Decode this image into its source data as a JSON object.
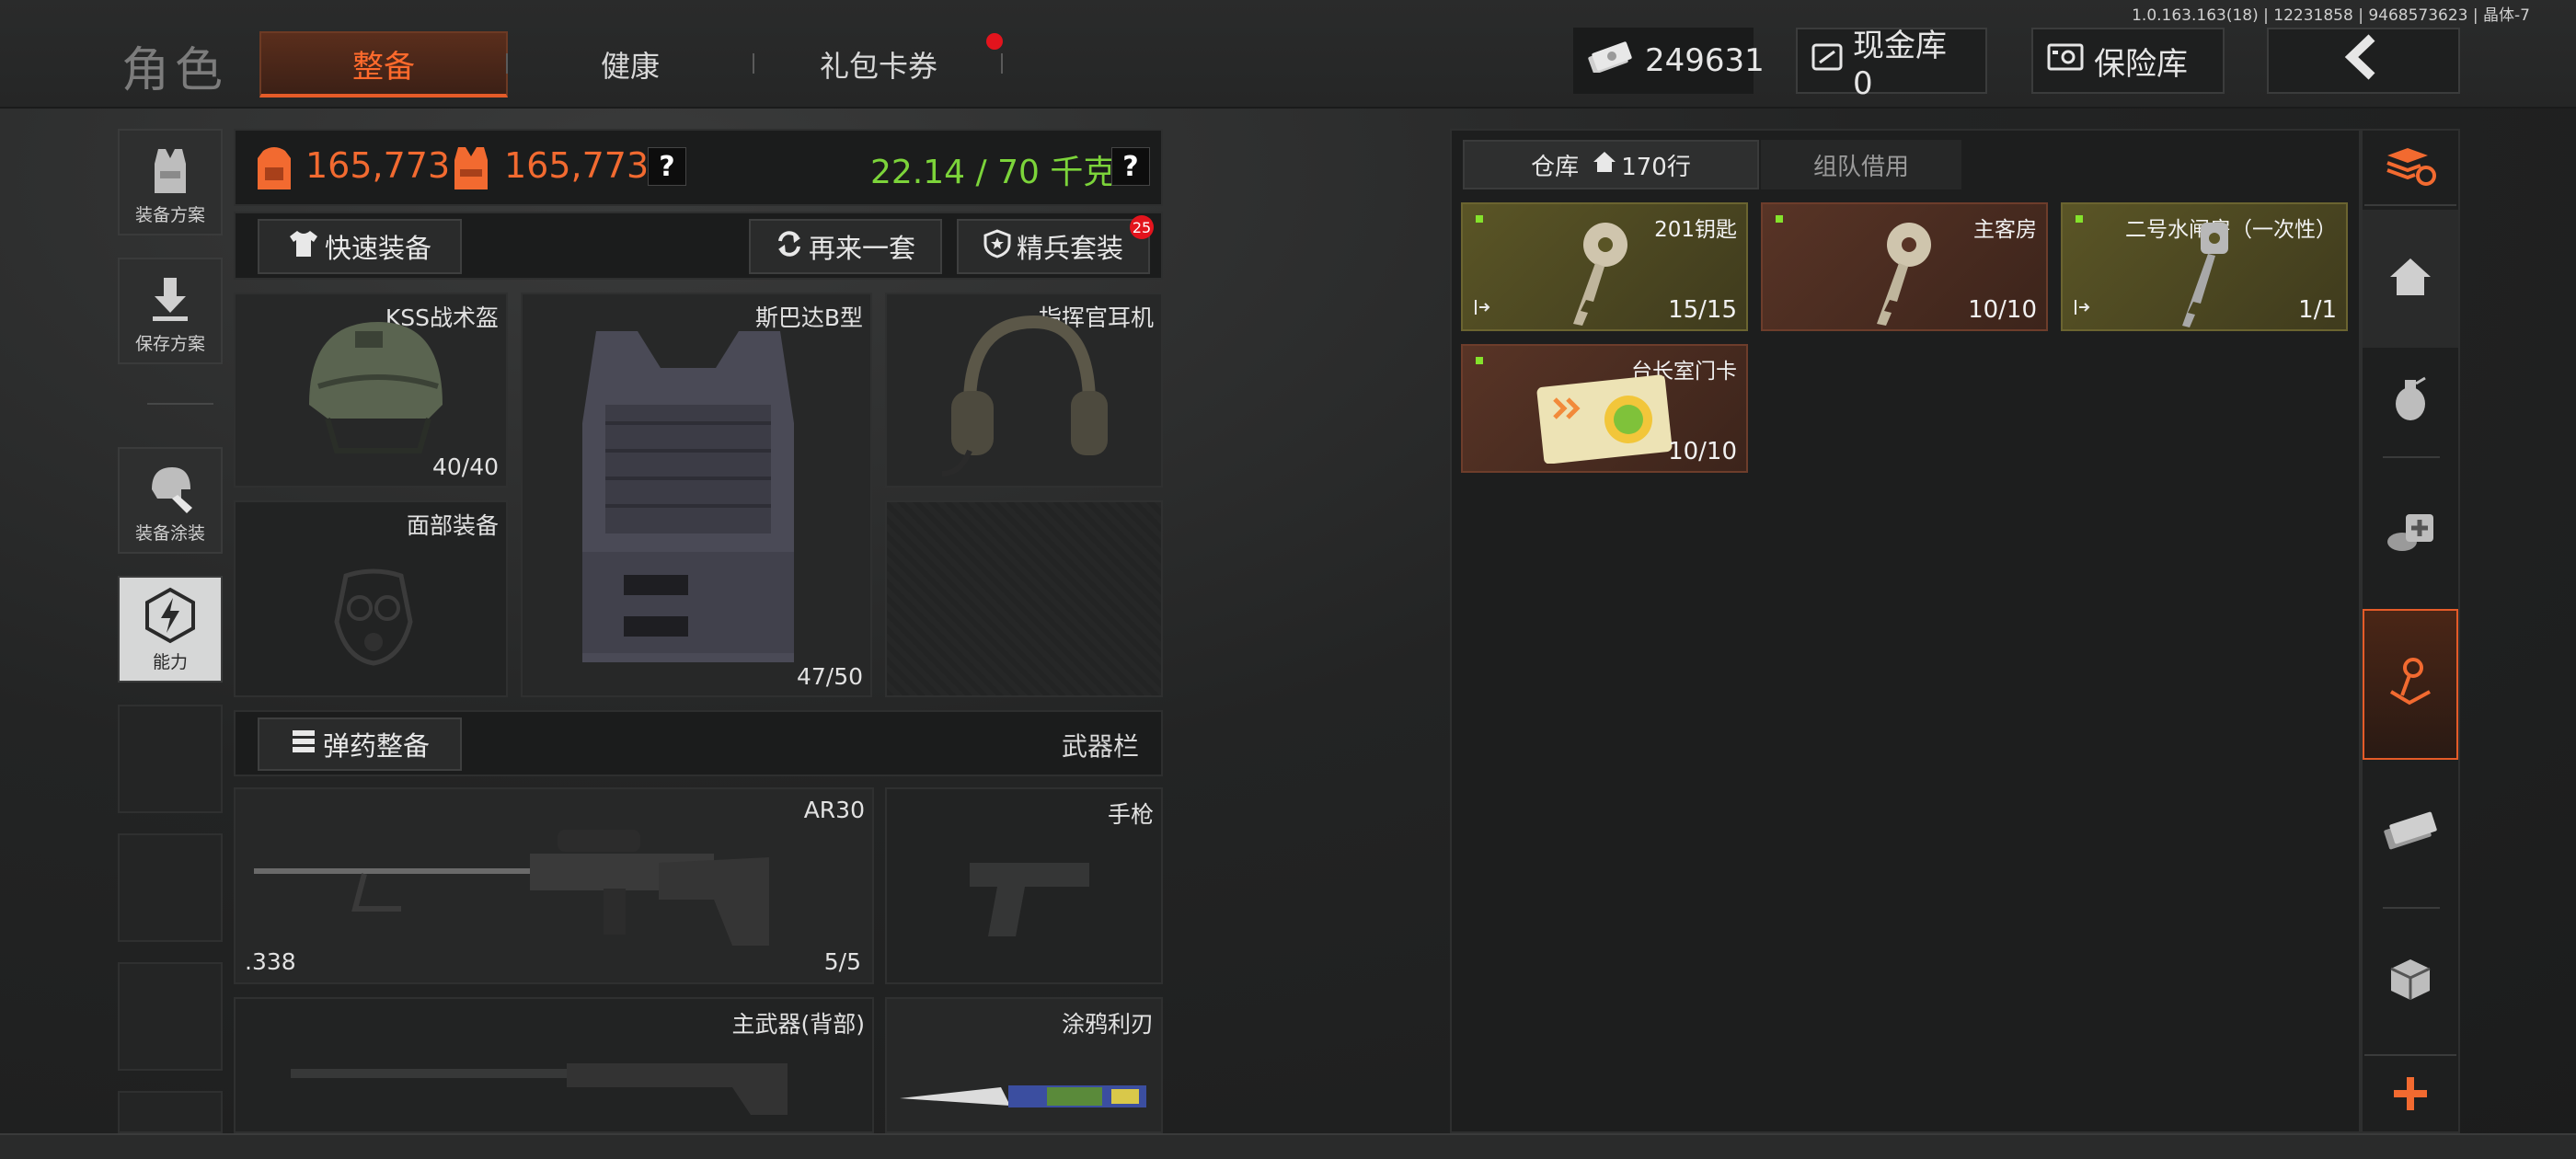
{
  "version": "1.0.163.163(18) | 12231858 | 9468573623 | 晶体-7",
  "header": {
    "title": "角色",
    "tabs": [
      {
        "label": "整备",
        "active": true
      },
      {
        "label": "健康",
        "active": false
      },
      {
        "label": "礼包卡券",
        "active": false,
        "badge": true
      }
    ],
    "currency": "249631",
    "cash_vault": "现金库 0",
    "safe_box": "保险库"
  },
  "sidebar": {
    "items": [
      {
        "label": "装备方案"
      },
      {
        "label": "保存方案"
      },
      {
        "label": "装备涂装"
      },
      {
        "label": "能力"
      }
    ]
  },
  "stats": {
    "value1": "165,773",
    "value2": "165,773",
    "weight": "22.14 / 70 千克",
    "help": "?"
  },
  "actions": {
    "quick_equip": "快速装备",
    "again": "再来一套",
    "elite_set": "精兵套装",
    "elite_badge": "25",
    "ammo_equip": "弹药整备",
    "weapon_bar": "武器栏"
  },
  "equipment": {
    "helmet": {
      "name": "KSS战术盔",
      "durability": "40/40"
    },
    "armor": {
      "name": "斯巴达B型",
      "durability": "47/50"
    },
    "headset": {
      "name": "指挥官耳机"
    },
    "face": {
      "name": "面部装备"
    },
    "primary": {
      "name": "AR30",
      "ammo": ".338",
      "count": "5/5"
    },
    "pistol": {
      "name": "手枪"
    },
    "backpack_weapon": {
      "name": "主武器(背部)"
    },
    "melee": {
      "name": "涂鸦利刃"
    }
  },
  "inventory": {
    "tab_warehouse": "仓库",
    "tab_rows": "170行",
    "tab_team": "组队借用",
    "items": [
      {
        "name": "201钥匙",
        "count": "15/15",
        "color": "yellow"
      },
      {
        "name": "主客房",
        "count": "10/10",
        "color": "brown"
      },
      {
        "name": "二号水闸房（一次性）",
        "count": "1/1",
        "color": "yellow"
      },
      {
        "name": "台长室门卡",
        "count": "10/10",
        "color": "brown"
      }
    ]
  },
  "right_nav": [
    "stack-refresh-icon",
    "home-icon",
    "grenade-icon",
    "medkit-icon",
    "key-icon",
    "cash-icon",
    "box-icon",
    "add-icon"
  ],
  "colors": {
    "accent": "#f26a30",
    "weight": "#7cd43a",
    "badge": "#e3141d"
  }
}
